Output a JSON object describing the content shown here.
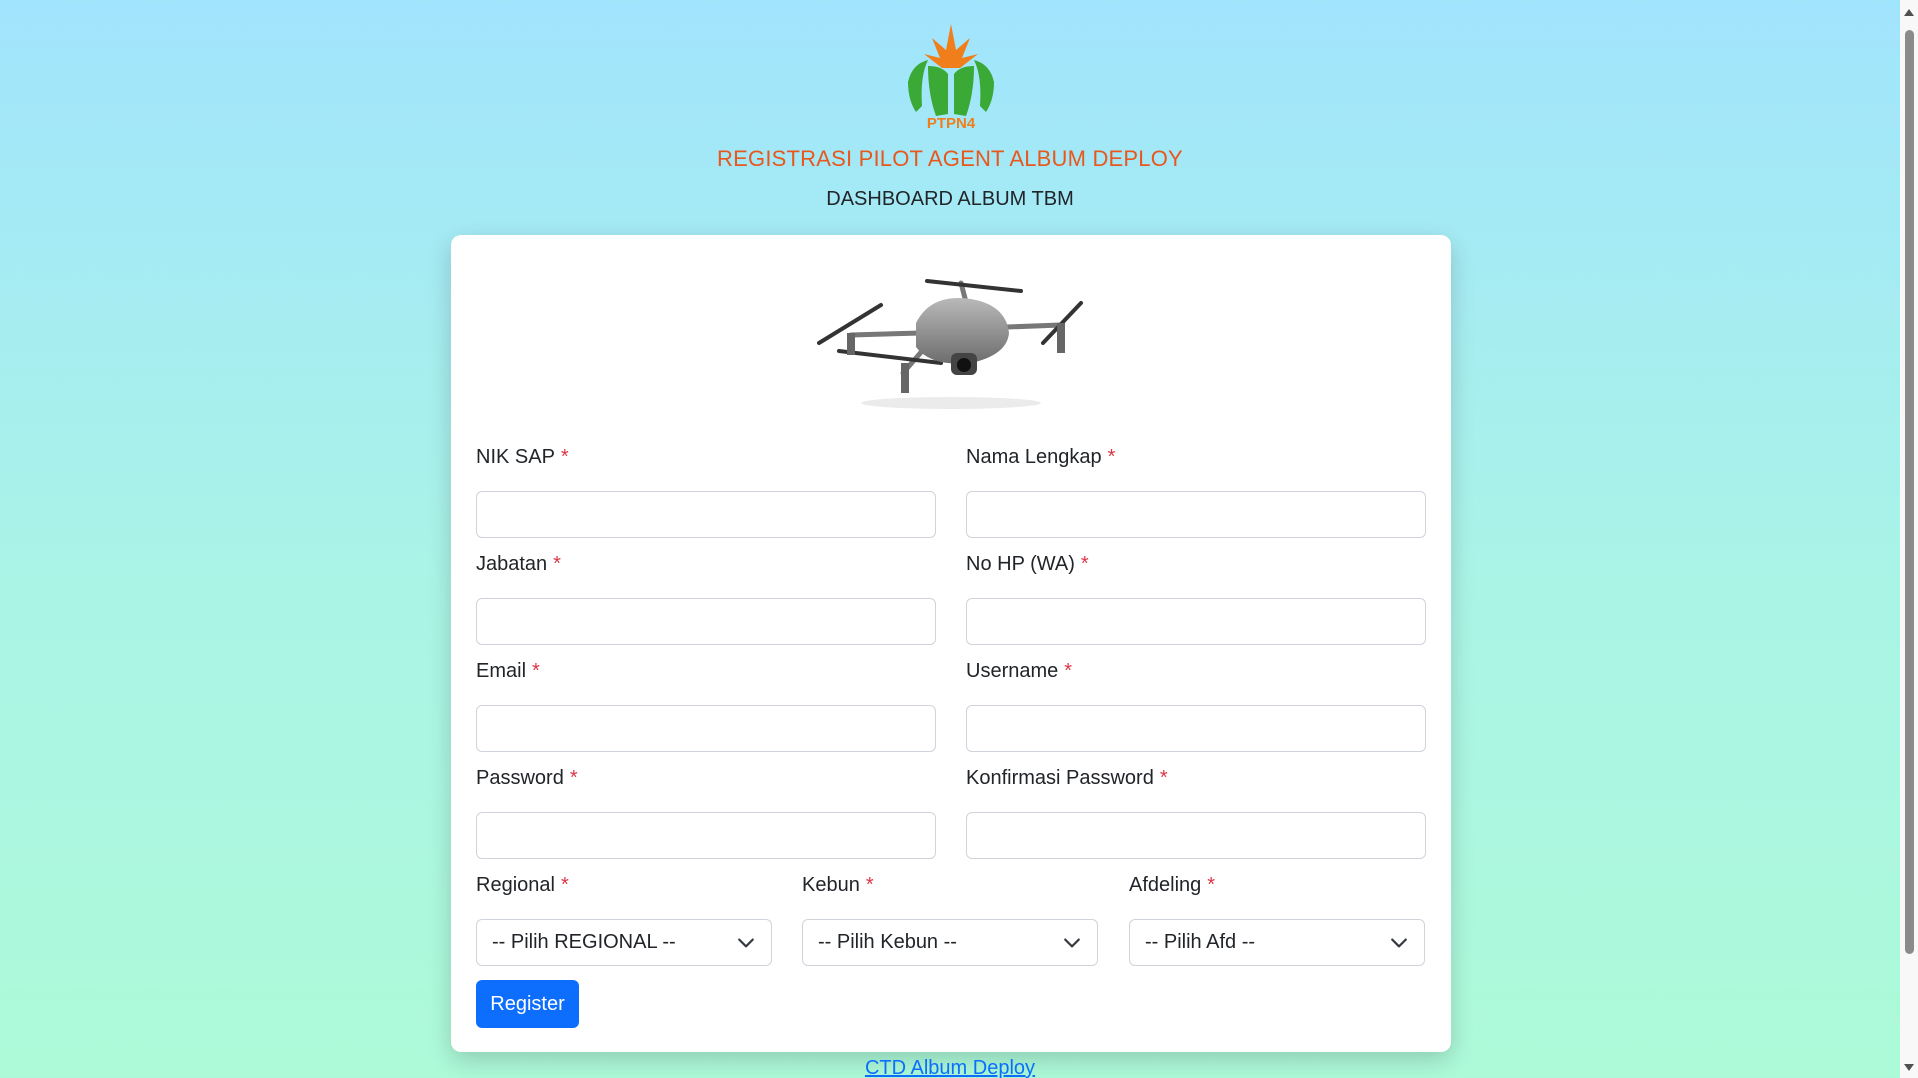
{
  "header": {
    "logo_text": "PTPN4",
    "title": "REGISTRASI PILOT AGENT ALBUM DEPLOY",
    "subtitle": "DASHBOARD ALBUM TBM"
  },
  "form": {
    "required_mark": "*",
    "nik": {
      "label": "NIK SAP",
      "value": ""
    },
    "nama": {
      "label": "Nama Lengkap",
      "value": ""
    },
    "jabatan": {
      "label": "Jabatan",
      "value": ""
    },
    "nohp": {
      "label": "No HP (WA)",
      "value": ""
    },
    "email": {
      "label": "Email",
      "value": ""
    },
    "username": {
      "label": "Username",
      "value": ""
    },
    "password": {
      "label": "Password",
      "value": ""
    },
    "konfirmasi": {
      "label": "Konfirmasi Password",
      "value": ""
    },
    "regional": {
      "label": "Regional",
      "selected": "-- Pilih REGIONAL --"
    },
    "kebun": {
      "label": "Kebun",
      "selected": "-- Pilih Kebun --"
    },
    "afdeling": {
      "label": "Afdeling",
      "selected": "-- Pilih Afd --"
    },
    "register_label": "Register"
  },
  "footer": {
    "link_text": "CTD Album Deploy"
  },
  "colors": {
    "accent": "#0d6efd",
    "title": "#e8581c",
    "required": "#dc3545",
    "logo_green": "#3aa935",
    "logo_orange": "#f07f1b"
  }
}
